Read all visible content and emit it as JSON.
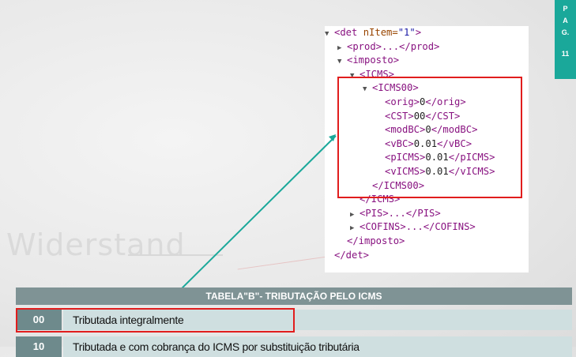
{
  "watermark": "Widerstand",
  "page_badge": {
    "letters": [
      "P",
      "A",
      "G."
    ],
    "number": "11"
  },
  "xml_lines": [
    {
      "tri": "▼",
      "indent": 0,
      "text": "<det ",
      "attr": "nItem=",
      "aval": "\"1\"",
      "close": ">"
    },
    {
      "tri": "▶",
      "indent": 1,
      "text": "<prod>...</prod>"
    },
    {
      "tri": "▼",
      "indent": 1,
      "text": "<imposto>"
    },
    {
      "tri": "▼",
      "indent": 2,
      "text": "<ICMS>"
    },
    {
      "tri": "▼",
      "indent": 3,
      "text": "<ICMS00>"
    },
    {
      "tri": "",
      "indent": 4,
      "tag": "orig",
      "val": "0"
    },
    {
      "tri": "",
      "indent": 4,
      "tag": "CST",
      "val": "00"
    },
    {
      "tri": "",
      "indent": 4,
      "tag": "modBC",
      "val": "0"
    },
    {
      "tri": "",
      "indent": 4,
      "tag": "vBC",
      "val": "0.01"
    },
    {
      "tri": "",
      "indent": 4,
      "tag": "pICMS",
      "val": "0.01"
    },
    {
      "tri": "",
      "indent": 4,
      "tag": "vICMS",
      "val": "0.01"
    },
    {
      "tri": "",
      "indent": 3,
      "text": "</ICMS00>"
    },
    {
      "tri": "",
      "indent": 2,
      "text": "</ICMS>"
    },
    {
      "tri": "▶",
      "indent": 2,
      "text": "<PIS>...</PIS>"
    },
    {
      "tri": "▶",
      "indent": 2,
      "text": "<COFINS>...</COFINS>"
    },
    {
      "tri": "",
      "indent": 1,
      "text": "</imposto>"
    },
    {
      "tri": "",
      "indent": 0,
      "text": "</det>"
    }
  ],
  "table": {
    "title": "TABELA\"B\"- TRIBUTAÇÃO PELO ICMS",
    "rows": [
      {
        "code": "00",
        "desc": "Tributada integralmente"
      },
      {
        "code": "10",
        "desc": "Tributada e com cobrança do ICMS por substituição tributária"
      }
    ]
  },
  "colors": {
    "accent": "#1aa89a",
    "highlight": "#e11d1d",
    "table_header": "#7f9395",
    "code_cell": "#6e8a8c",
    "row_bg": "#cfdfe0"
  }
}
